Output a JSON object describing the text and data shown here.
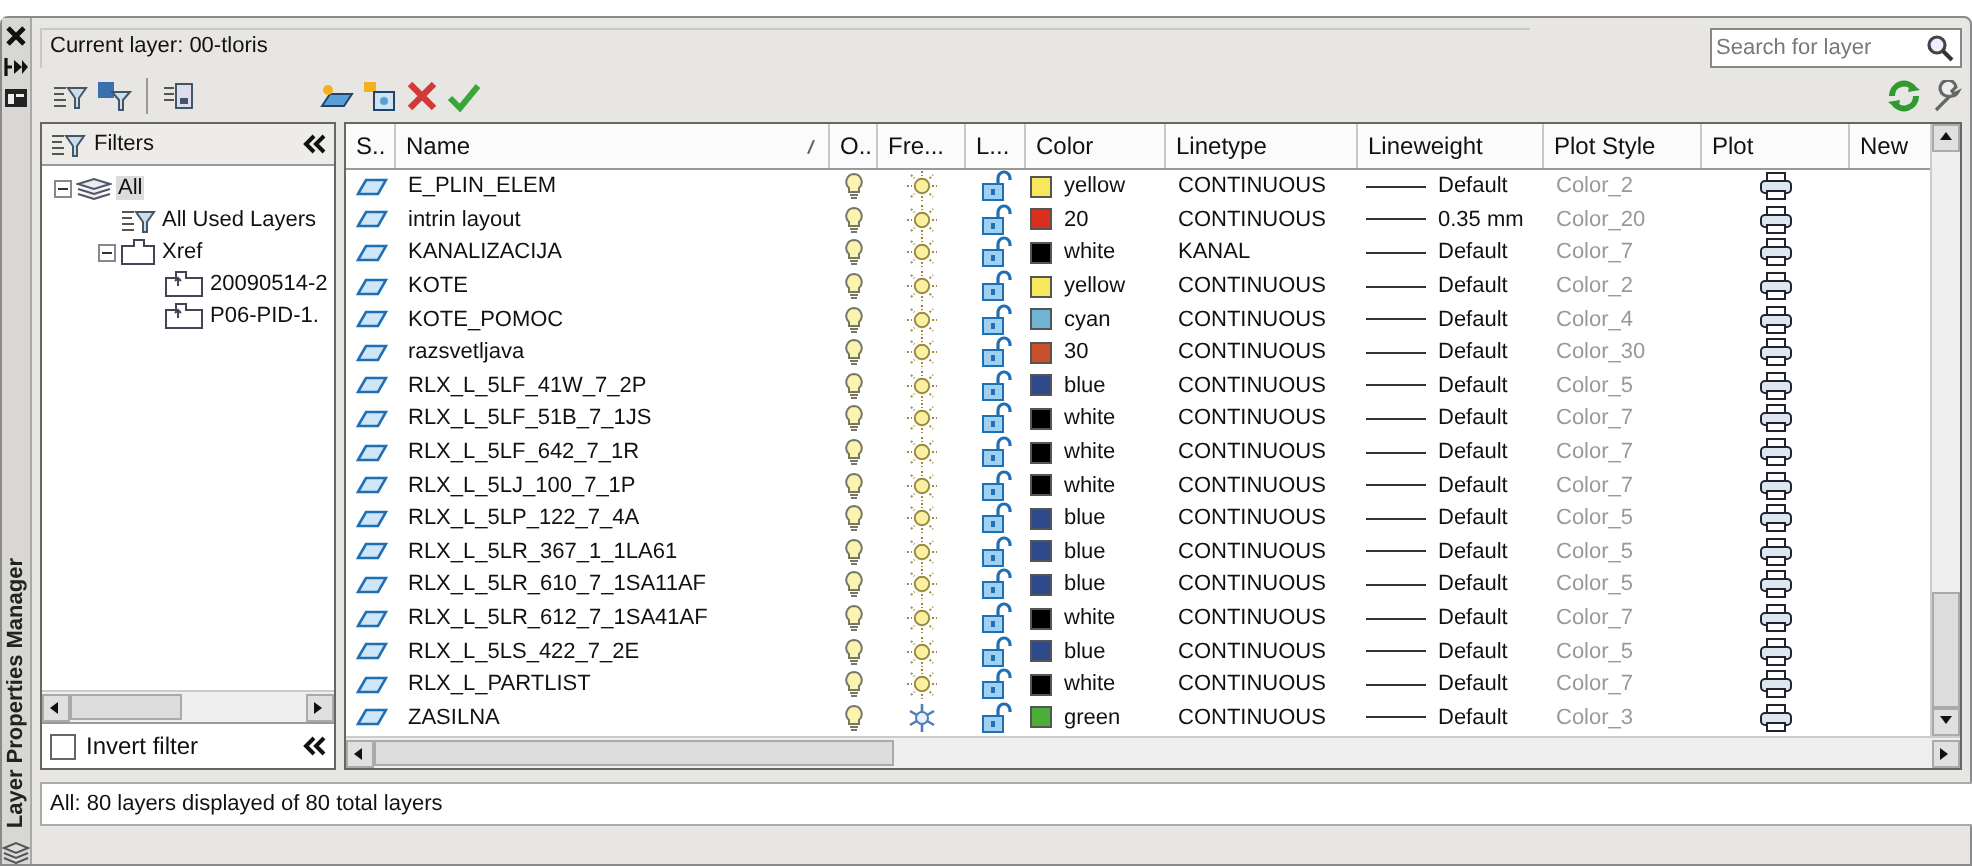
{
  "window": {
    "title": "Layer Properties Manager"
  },
  "current_layer": "Current layer: 00-tloris",
  "search": {
    "placeholder": "Search for layer"
  },
  "filters": {
    "title": "Filters",
    "tree": [
      {
        "label": "All",
        "selected": true,
        "expanded": true,
        "kind": "all",
        "children": [
          {
            "label": "All Used Layers",
            "selected": false,
            "kind": "filter"
          },
          {
            "label": "Xref",
            "selected": false,
            "expanded": true,
            "kind": "group",
            "children": [
              {
                "label": "20090514-2",
                "selected": false,
                "kind": "xref"
              },
              {
                "label": "P06-PID-1.",
                "selected": false,
                "kind": "xref"
              }
            ]
          }
        ]
      }
    ],
    "invert_filter": {
      "label": "Invert filter",
      "checked": false
    }
  },
  "table": {
    "columns": [
      "S..",
      "Name",
      "O..",
      "Fre...",
      "L...",
      "Color",
      "Linetype",
      "Lineweight",
      "Plot Style",
      "Plot",
      "New"
    ],
    "rows": [
      {
        "name": "E_PLIN_ELEM",
        "on": true,
        "frozen": false,
        "locked": false,
        "color_name": "yellow",
        "color": "#f5e85a",
        "linetype": "CONTINUOUS",
        "lineweight": "Default",
        "plot_style": "Color_2"
      },
      {
        "name": "intrin layout",
        "on": true,
        "frozen": false,
        "locked": false,
        "color_name": "20",
        "color": "#d8301c",
        "linetype": "CONTINUOUS",
        "lineweight": "0.35 mm",
        "plot_style": "Color_20"
      },
      {
        "name": "KANALIZACIJA",
        "on": true,
        "frozen": false,
        "locked": false,
        "color_name": "white",
        "color": "#000000",
        "linetype": "KANAL",
        "lineweight": "Default",
        "plot_style": "Color_7"
      },
      {
        "name": "KOTE",
        "on": true,
        "frozen": false,
        "locked": false,
        "color_name": "yellow",
        "color": "#f5e85a",
        "linetype": "CONTINUOUS",
        "lineweight": "Default",
        "plot_style": "Color_2"
      },
      {
        "name": "KOTE_POMOC",
        "on": true,
        "frozen": false,
        "locked": false,
        "color_name": "cyan",
        "color": "#6fb4d0",
        "linetype": "CONTINUOUS",
        "lineweight": "Default",
        "plot_style": "Color_4"
      },
      {
        "name": "razsvetljava",
        "on": true,
        "frozen": false,
        "locked": false,
        "color_name": "30",
        "color": "#c8502a",
        "linetype": "CONTINUOUS",
        "lineweight": "Default",
        "plot_style": "Color_30"
      },
      {
        "name": "RLX_L_5LF_41W_7_2P",
        "on": true,
        "frozen": false,
        "locked": false,
        "color_name": "blue",
        "color": "#2f4a8c",
        "linetype": "CONTINUOUS",
        "lineweight": "Default",
        "plot_style": "Color_5"
      },
      {
        "name": "RLX_L_5LF_51B_7_1JS",
        "on": true,
        "frozen": false,
        "locked": false,
        "color_name": "white",
        "color": "#000000",
        "linetype": "CONTINUOUS",
        "lineweight": "Default",
        "plot_style": "Color_7"
      },
      {
        "name": "RLX_L_5LF_642_7_1R",
        "on": true,
        "frozen": false,
        "locked": false,
        "color_name": "white",
        "color": "#000000",
        "linetype": "CONTINUOUS",
        "lineweight": "Default",
        "plot_style": "Color_7"
      },
      {
        "name": "RLX_L_5LJ_100_7_1P",
        "on": true,
        "frozen": false,
        "locked": false,
        "color_name": "white",
        "color": "#000000",
        "linetype": "CONTINUOUS",
        "lineweight": "Default",
        "plot_style": "Color_7"
      },
      {
        "name": "RLX_L_5LP_122_7_4A",
        "on": true,
        "frozen": false,
        "locked": false,
        "color_name": "blue",
        "color": "#2f4a8c",
        "linetype": "CONTINUOUS",
        "lineweight": "Default",
        "plot_style": "Color_5"
      },
      {
        "name": "RLX_L_5LR_367_1_1LA61",
        "on": true,
        "frozen": false,
        "locked": false,
        "color_name": "blue",
        "color": "#2f4a8c",
        "linetype": "CONTINUOUS",
        "lineweight": "Default",
        "plot_style": "Color_5"
      },
      {
        "name": "RLX_L_5LR_610_7_1SA11AF",
        "on": true,
        "frozen": false,
        "locked": false,
        "color_name": "blue",
        "color": "#2f4a8c",
        "linetype": "CONTINUOUS",
        "lineweight": "Default",
        "plot_style": "Color_5"
      },
      {
        "name": "RLX_L_5LR_612_7_1SA41AF",
        "on": true,
        "frozen": false,
        "locked": false,
        "color_name": "white",
        "color": "#000000",
        "linetype": "CONTINUOUS",
        "lineweight": "Default",
        "plot_style": "Color_7"
      },
      {
        "name": "RLX_L_5LS_422_7_2E",
        "on": true,
        "frozen": false,
        "locked": false,
        "color_name": "blue",
        "color": "#2f4a8c",
        "linetype": "CONTINUOUS",
        "lineweight": "Default",
        "plot_style": "Color_5"
      },
      {
        "name": "RLX_L_PARTLIST",
        "on": true,
        "frozen": false,
        "locked": false,
        "color_name": "white",
        "color": "#000000",
        "linetype": "CONTINUOUS",
        "lineweight": "Default",
        "plot_style": "Color_7"
      },
      {
        "name": "ZASILNA",
        "on": true,
        "frozen": true,
        "locked": false,
        "color_name": "green",
        "color": "#4caf3a",
        "linetype": "CONTINUOUS",
        "lineweight": "Default",
        "plot_style": "Color_3"
      }
    ]
  },
  "status_bar": "All: 80 layers displayed of 80 total layers"
}
